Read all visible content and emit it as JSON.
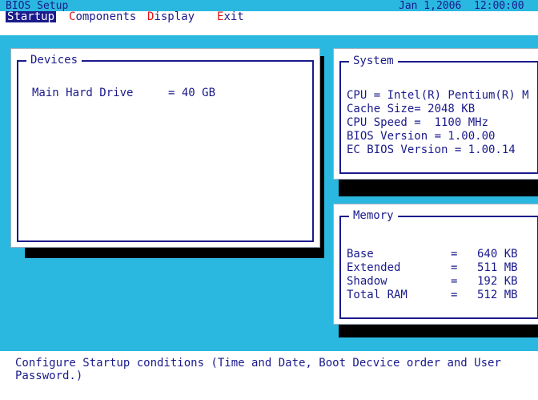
{
  "title_bar": {
    "title": "BIOS Setup",
    "date": "Jan 1,2006",
    "time": "12:00:00"
  },
  "menu": {
    "items": [
      {
        "hotkey": "S",
        "rest": "tartup",
        "active": true
      },
      {
        "hotkey": "C",
        "rest": "omponents",
        "active": false
      },
      {
        "hotkey": "D",
        "rest": "isplay",
        "active": false
      },
      {
        "hotkey": "E",
        "rest": "xit",
        "active": false
      }
    ]
  },
  "devices": {
    "title": "Devices",
    "main_hard_drive_label": "Main Hard Drive",
    "main_hard_drive_value": "= 40 GB"
  },
  "system": {
    "title": "System",
    "lines": [
      "CPU = Intel(R) Pentium(R) M",
      "Cache Size= 2048 KB",
      "CPU Speed =  1100 MHz",
      "BIOS Version = 1.00.00",
      "EC BIOS Version = 1.00.14"
    ]
  },
  "memory": {
    "title": "Memory",
    "rows": [
      {
        "label": "Base",
        "eq": "=",
        "value": "640 KB"
      },
      {
        "label": "Extended",
        "eq": "=",
        "value": "511 MB"
      },
      {
        "label": "Shadow",
        "eq": "=",
        "value": "192 KB"
      },
      {
        "label": "Total RAM",
        "eq": "=",
        "value": "512 MB"
      }
    ]
  },
  "help": {
    "text": "Configure Startup conditions (Time and Date, Boot Decvice order and User\nPassword.)"
  },
  "colors": {
    "background": "#2bb8e0",
    "text": "#1a1a8c",
    "hotkey": "#e01414",
    "panel": "#ffffff",
    "shadow": "#000000"
  }
}
